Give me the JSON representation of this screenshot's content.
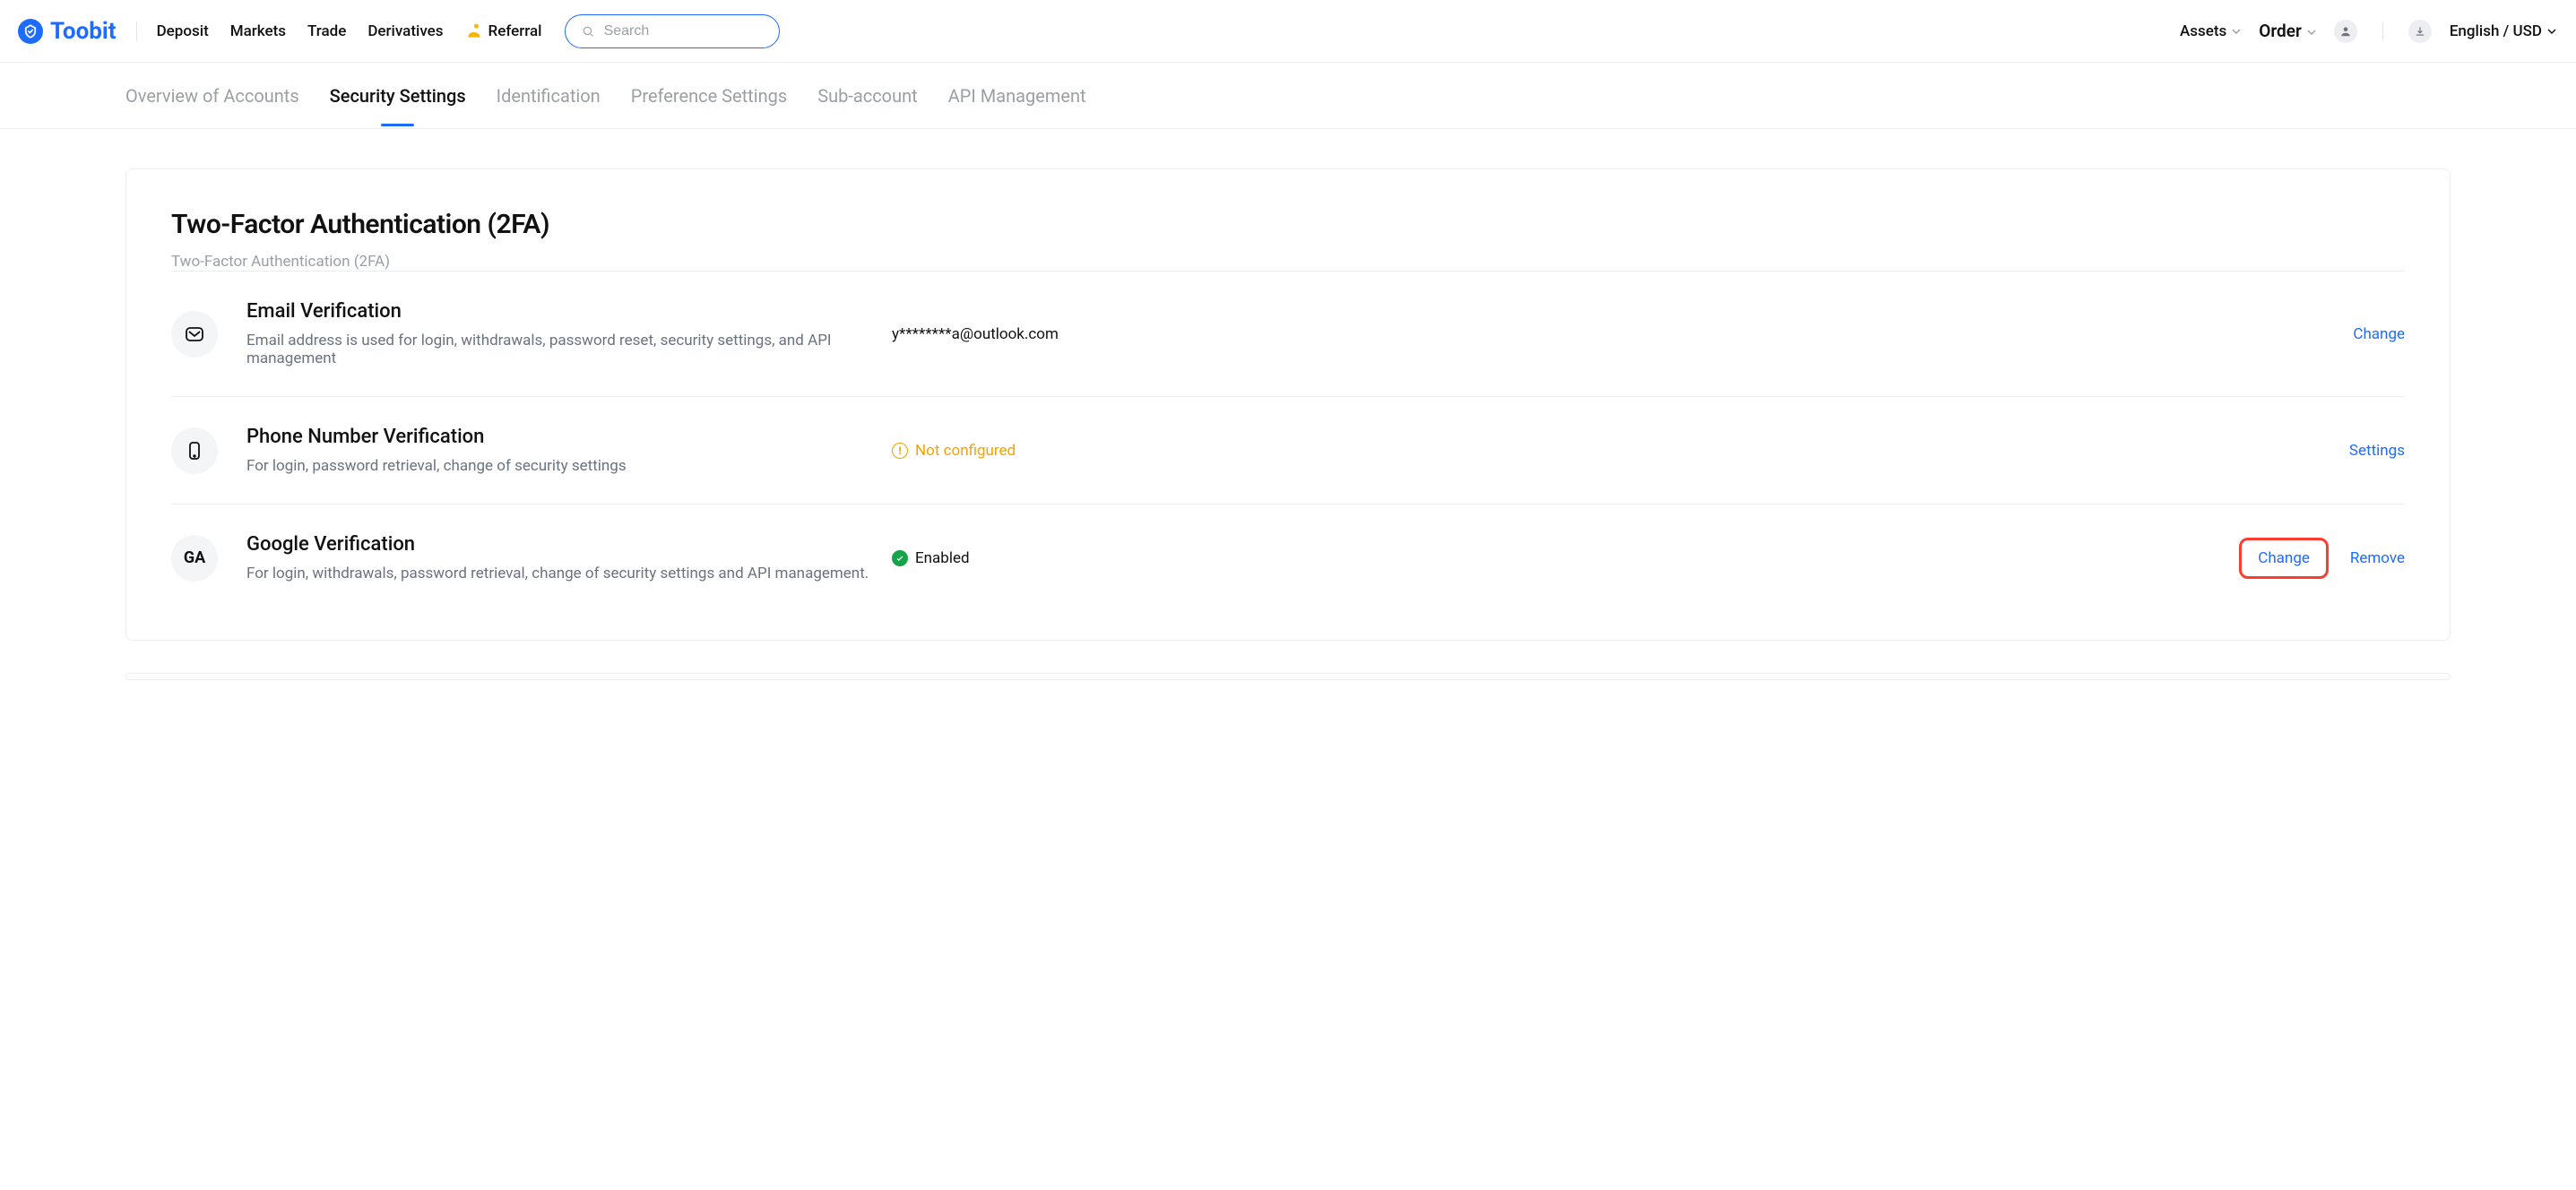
{
  "brand": {
    "name": "Toobit"
  },
  "nav": {
    "deposit": "Deposit",
    "markets": "Markets",
    "trade": "Trade",
    "derivatives": "Derivatives",
    "referral": "Referral"
  },
  "search": {
    "placeholder": "Search"
  },
  "top_right": {
    "assets": "Assets",
    "order": "Order",
    "lang": "English / USD"
  },
  "subnav": {
    "overview": "Overview of Accounts",
    "security": "Security Settings",
    "identification": "Identification",
    "preference": "Preference Settings",
    "subaccount": "Sub-account",
    "api": "API Management"
  },
  "section": {
    "title": "Two-Factor Authentication (2FA)",
    "subtitle": "Two-Factor Authentication (2FA)"
  },
  "rows": {
    "email": {
      "title": "Email Verification",
      "desc": "Email address is used for login, withdrawals, password reset, security settings, and API management",
      "value": "y********a@outlook.com",
      "action": "Change"
    },
    "phone": {
      "title": "Phone Number Verification",
      "desc": "For login, password retrieval, change of security settings",
      "status": "Not configured",
      "action": "Settings"
    },
    "google": {
      "title": "Google Verification",
      "desc": "For login, withdrawals, password retrieval, change of security settings and API management.",
      "status": "Enabled",
      "icon_text": "GA",
      "action_change": "Change",
      "action_remove": "Remove"
    }
  }
}
